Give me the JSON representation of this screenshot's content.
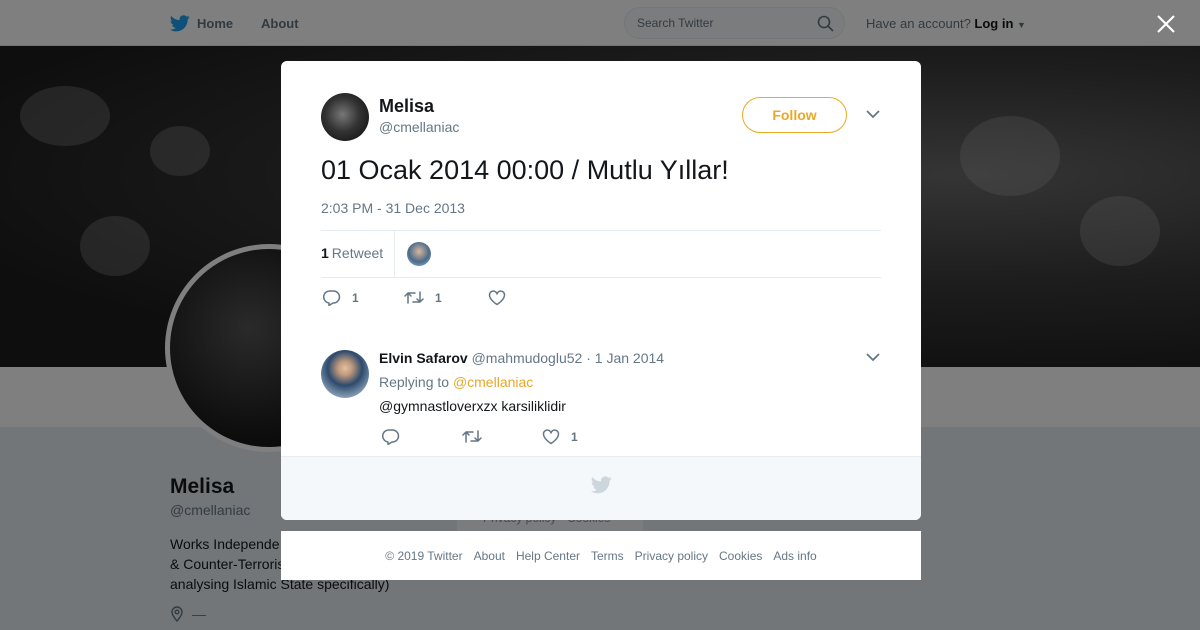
{
  "topbar": {
    "home_label": "Home",
    "about_label": "About",
    "search_placeholder": "Search Twitter",
    "account_prompt": "Have an account?",
    "login_label": "Log in"
  },
  "profile": {
    "name": "Melisa",
    "handle": "@cmellaniac",
    "bio": "Works Independe... & Counter-Terrorism... analysing Islamic State specifically)",
    "bio_line1": "Works Independe",
    "bio_line2": "& Counter-Terroris",
    "bio_line3": "analysing Islamic State specifically)",
    "location": "—",
    "privacy_text": "Privacy policy · Cookies"
  },
  "tweet": {
    "author_name": "Melisa",
    "author_handle": "@cmellaniac",
    "follow_label": "Follow",
    "text": "01 Ocak 2014 00:00 / Mutlu Yıllar!",
    "timestamp": "2:03 PM - 31 Dec 2013",
    "retweet_count": "1",
    "retweet_label": "Retweet",
    "reply_count": "1",
    "rt_action_count": "1",
    "like_count": ""
  },
  "reply": {
    "author_name": "Elvin Safarov",
    "author_handle": "@mahmudoglu52",
    "date": "· 1 Jan 2014",
    "replying_prefix": "Replying to",
    "replying_handle": "@cmellaniac",
    "text": "@gymnastloverxzx karsiliklidir",
    "reply_count": "",
    "rt_count": "",
    "like_count": "1"
  },
  "footer": {
    "copyright": "© 2019 Twitter",
    "links": [
      "About",
      "Help Center",
      "Terms",
      "Privacy policy",
      "Cookies",
      "Ads info"
    ]
  },
  "colors": {
    "accent": "#e9a826",
    "twitter_blue": "#1da1f2",
    "text_secondary": "#657786"
  },
  "icons": [
    "twitter-bird-icon",
    "search-icon",
    "close-icon",
    "chevron-down-icon",
    "reply-icon",
    "retweet-icon",
    "heart-icon",
    "location-icon"
  ]
}
